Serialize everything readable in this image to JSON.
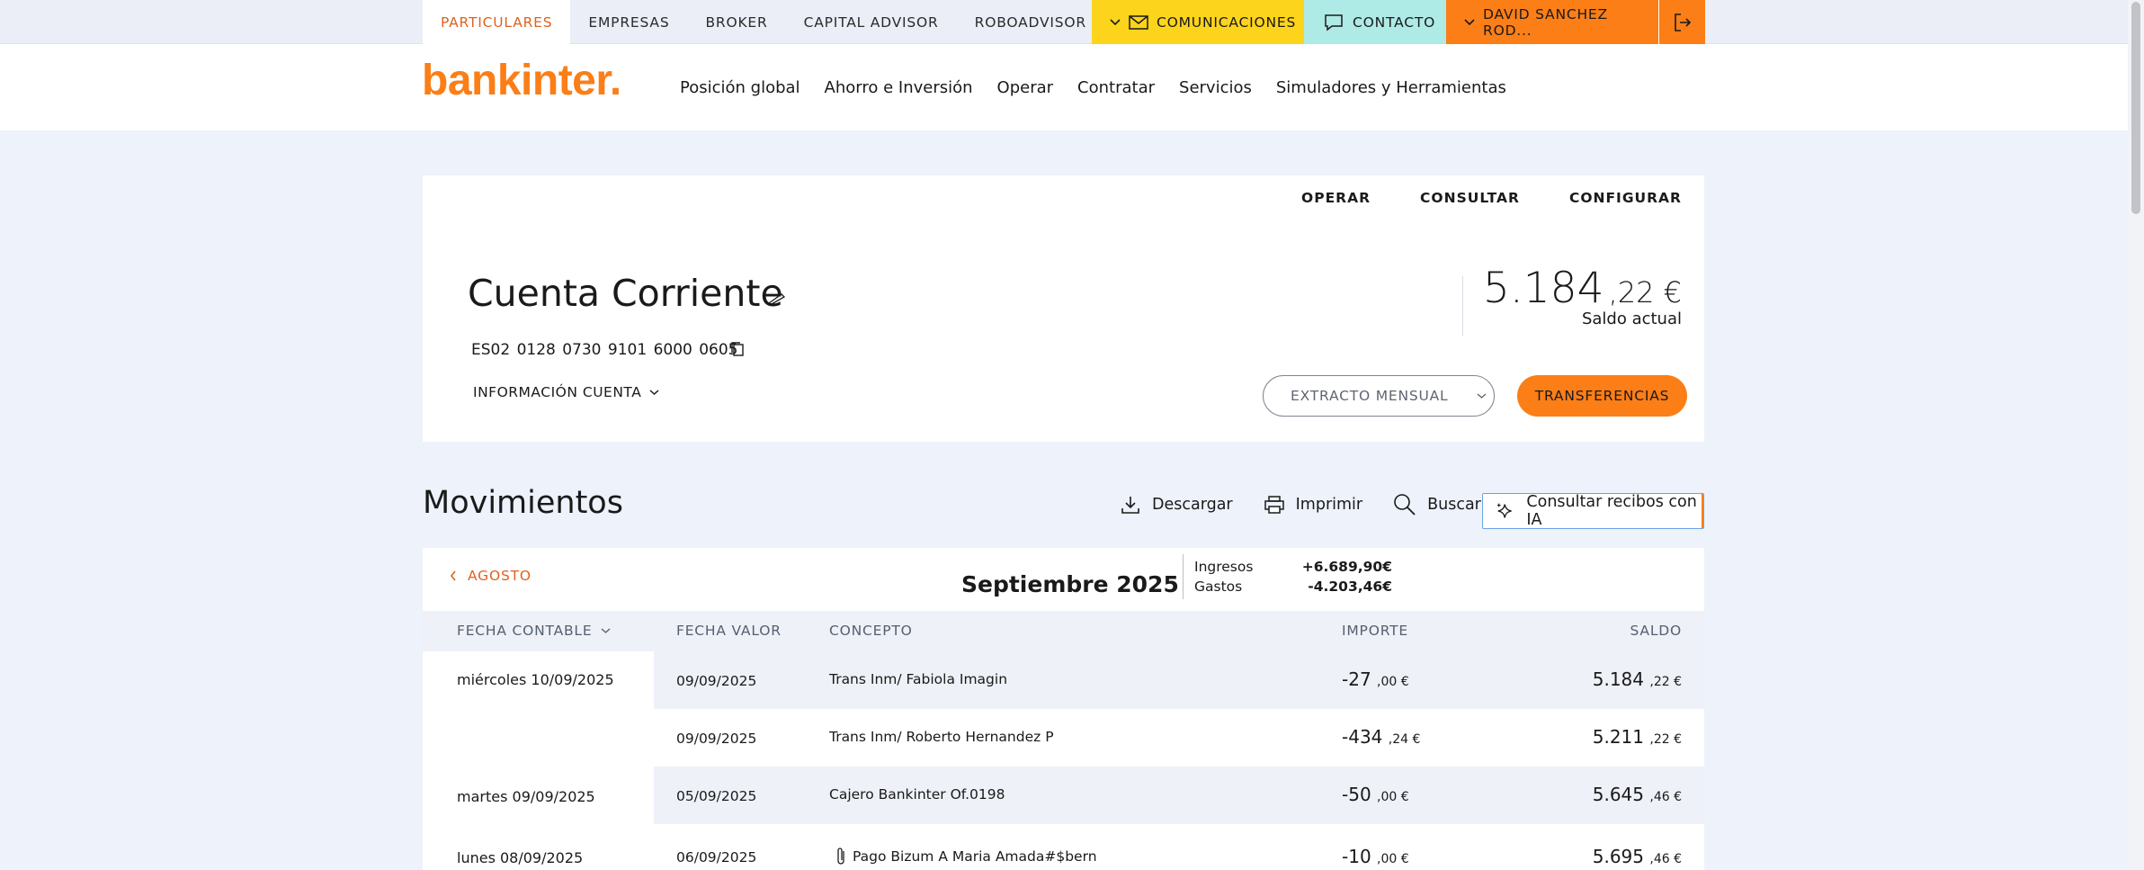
{
  "topnav": {
    "items": [
      {
        "label": "PARTICULARES",
        "active": true
      },
      {
        "label": "EMPRESAS",
        "active": false
      },
      {
        "label": "BROKER",
        "active": false
      },
      {
        "label": "CAPITAL ADVISOR",
        "active": false
      },
      {
        "label": "ROBOADVISOR",
        "active": false
      }
    ],
    "comunicaciones": "COMUNICACIONES",
    "contacto": "CONTACTO",
    "user": "DAVID SANCHEZ ROD..."
  },
  "header": {
    "logo": "bankinter.",
    "nav": [
      "Posición global",
      "Ahorro e Inversión",
      "Operar",
      "Contratar",
      "Servicios",
      "Simuladores y Herramientas"
    ]
  },
  "account": {
    "actions": [
      "OPERAR",
      "CONSULTAR",
      "CONFIGURAR"
    ],
    "title": "Cuenta Corriente",
    "iban": "ES02 0128 0730 9101 6000 0605",
    "info_label": "INFORMACIÓN CUENTA",
    "balance_int": "5.184",
    "balance_dec": ",22 €",
    "balance_label": "Saldo actual",
    "extracto_label": "EXTRACTO MENSUAL",
    "transfer_label": "TRANSFERENCIAS"
  },
  "movements": {
    "title": "Movimientos",
    "tools": {
      "download": "Descargar",
      "print": "Imprimir",
      "search": "Buscar",
      "ai": "Consultar recibos con IA"
    },
    "prev_month": "AGOSTO",
    "month": "Septiembre 2025",
    "income_label": "Ingresos",
    "income_value": "+6.689,90€",
    "expense_label": "Gastos",
    "expense_value": "-4.203,46€",
    "columns": {
      "fecha_contable": "FECHA CONTABLE",
      "fecha_valor": "FECHA VALOR",
      "concepto": "CONCEPTO",
      "importe": "IMPORTE",
      "saldo": "SALDO"
    },
    "rows": [
      {
        "date": "miércoles 10/09/2025",
        "value_date": "09/09/2025",
        "concept": "Trans Inm/ Fabiola Imagin",
        "amount_int": "-27",
        "amount_dec": ",00 €",
        "balance_int": "5.184",
        "balance_dec": ",22 €"
      },
      {
        "date": "",
        "value_date": "09/09/2025",
        "concept": "Trans Inm/ Roberto Hernandez P",
        "amount_int": "-434",
        "amount_dec": ",24 €",
        "balance_int": "5.211",
        "balance_dec": ",22 €"
      },
      {
        "date": "martes 09/09/2025",
        "value_date": "05/09/2025",
        "concept": "Cajero Bankinter Of.0198",
        "amount_int": "-50",
        "amount_dec": ",00 €",
        "balance_int": "5.645",
        "balance_dec": ",46 €"
      },
      {
        "date": "lunes 08/09/2025",
        "value_date": "06/09/2025",
        "concept": "Pago Bizum A Maria Amada#$bern",
        "amount_int": "-10",
        "amount_dec": ",00 €",
        "balance_int": "5.695",
        "balance_dec": ",46 €"
      }
    ]
  }
}
